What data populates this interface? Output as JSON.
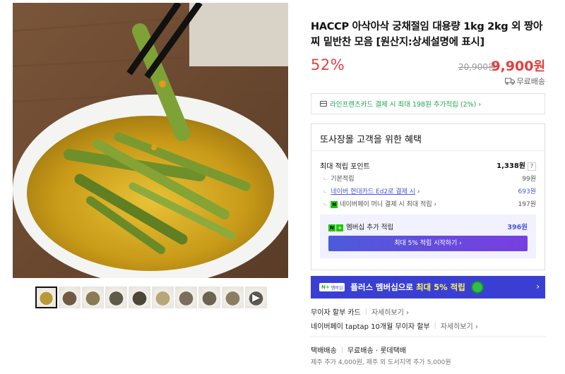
{
  "product": {
    "title": "HACCP 아삭아삭 궁채절임 대용량 1kg 2kg 외 짱아찌 밑반찬 모음 [원산지:상세설명에 표시]",
    "discount_rate": "52%",
    "original_price": "20,900원",
    "sale_price": "9,900",
    "sale_price_unit": "원",
    "shipping_badge": "무료배송"
  },
  "card_promo": "라인프렌즈카드 결제 시 최대 198원 추가적립 (2%) ›",
  "benefits": {
    "header": "또사장몰 고객을 위한 혜택",
    "max_point_label": "최대 적립 포인트",
    "max_point_value": "1,338원",
    "help": "?",
    "rows": [
      {
        "label": "기본적립",
        "value": "99원"
      },
      {
        "label": "네이버 현대카드 Ed2로 결제 시",
        "suffix": " ›",
        "value": "693원"
      },
      {
        "label": "네이버페이 머니 결제 시 최대 적립",
        "suffix": " ›",
        "value": "197원"
      }
    ],
    "membership_label": "멤버십 추가 적립",
    "membership_value": "396원",
    "membership_button": "최대 5% 적립 시작하기 ›"
  },
  "plus_banner": {
    "badge_text": "멤버십",
    "text_before": "플러스 멤버십으로 ",
    "text_highlight": "최대 5% 적립",
    "arrow": "›"
  },
  "installment": {
    "label": "무이자 할부 카드",
    "link": "자세히보기 ›"
  },
  "naverpay_installment": {
    "label": "네이버페이 taptap 10개월 무이자 할부",
    "link": "자세히보기 ›"
  },
  "delivery": {
    "type": "택배배송",
    "info": "무료배송 · 롯데택배",
    "extra": "제주 추가 4,000원, 제주 외 도서지역 추가 5,000원"
  },
  "thumbnails": [
    {
      "name": "thumb-1",
      "color": "#b89a35"
    },
    {
      "name": "thumb-2",
      "color": "#6f5a44"
    },
    {
      "name": "thumb-3",
      "color": "#8a7a55"
    },
    {
      "name": "thumb-4",
      "color": "#5f5a4a"
    },
    {
      "name": "thumb-5",
      "color": "#4b4638"
    },
    {
      "name": "thumb-6",
      "color": "#b8a67a"
    },
    {
      "name": "thumb-7",
      "color": "#7b6e5a"
    },
    {
      "name": "thumb-8",
      "color": "#6a6450"
    },
    {
      "name": "thumb-9",
      "color": "#8c7c62"
    },
    {
      "name": "thumb-10",
      "color": "#5e5a56",
      "video": true
    }
  ],
  "colors": {
    "accent_red": "#e53e3e",
    "naver_green": "#1ec800",
    "membership_blue": "#3a3fd4",
    "card_promo_green": "#1ea64a"
  }
}
